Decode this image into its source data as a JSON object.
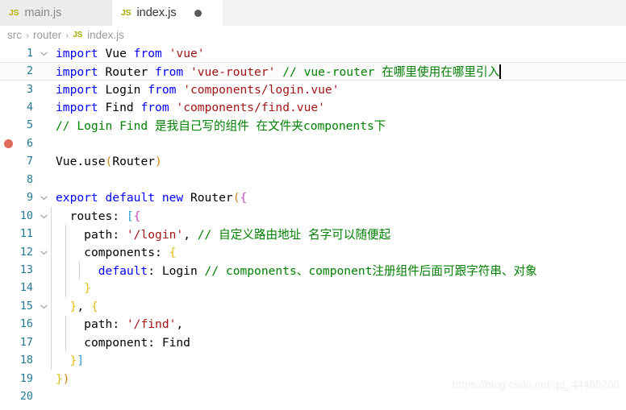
{
  "tabs": [
    {
      "icon": "js-file-icon",
      "icon_label": "JS",
      "label": "main.js",
      "active": false,
      "dirty": false
    },
    {
      "icon": "js-file-icon",
      "icon_label": "JS",
      "label": "index.js",
      "active": true,
      "dirty": true
    }
  ],
  "breadcrumb": {
    "items": [
      "src",
      "router",
      "index.js"
    ],
    "separator": "›",
    "file_icon_label": "JS"
  },
  "editor": {
    "language": "javascript",
    "cursor_line": 2,
    "breakpoint_line": 6,
    "lines": [
      {
        "n": "1",
        "fold": "open",
        "text": "import Vue from 'vue'"
      },
      {
        "n": "2",
        "fold": "",
        "text": "import Router from 'vue-router' // vue-router 在哪里使用在哪里引入"
      },
      {
        "n": "3",
        "fold": "",
        "text": "import Login from 'components/login.vue'"
      },
      {
        "n": "4",
        "fold": "",
        "text": "import Find from 'components/find.vue'"
      },
      {
        "n": "5",
        "fold": "",
        "text": "// Login Find 是我自己写的组件 在文件夹components下"
      },
      {
        "n": "6",
        "fold": "",
        "text": ""
      },
      {
        "n": "7",
        "fold": "",
        "text": "Vue.use(Router)"
      },
      {
        "n": "8",
        "fold": "",
        "text": ""
      },
      {
        "n": "9",
        "fold": "open",
        "text": "export default new Router({"
      },
      {
        "n": "10",
        "fold": "open",
        "text": "  routes: [{"
      },
      {
        "n": "11",
        "fold": "",
        "text": "    path: '/login', // 自定义路由地址 名字可以随便起"
      },
      {
        "n": "12",
        "fold": "open",
        "text": "    components: {"
      },
      {
        "n": "13",
        "fold": "",
        "text": "      default: Login // components、component注册组件后面可跟字符串、对象"
      },
      {
        "n": "14",
        "fold": "",
        "text": "    }"
      },
      {
        "n": "15",
        "fold": "open",
        "text": "  }, {"
      },
      {
        "n": "16",
        "fold": "",
        "text": "    path: '/find',"
      },
      {
        "n": "17",
        "fold": "",
        "text": "    component: Find"
      },
      {
        "n": "18",
        "fold": "",
        "text": "  }]"
      },
      {
        "n": "19",
        "fold": "",
        "text": "})"
      },
      {
        "n": "20",
        "fold": "",
        "text": ""
      }
    ]
  },
  "watermark": {
    "text": "https://blog.csdn.net/qq_44469200"
  },
  "colors": {
    "keyword": "#0000ff",
    "string": "#a31515",
    "comment": "#008000",
    "linenumber": "#237893",
    "bracket_orange": "#d18616",
    "bracket_blue": "#319bd6",
    "bracket_magenta": "#c94fc9",
    "bracket_yellow": "#e3bd12",
    "breakpoint": "#e06c5e",
    "tab_inactive_bg": "#ececec",
    "tabbar_bg": "#f3f3f3",
    "editor_bg": "#ffffff"
  }
}
